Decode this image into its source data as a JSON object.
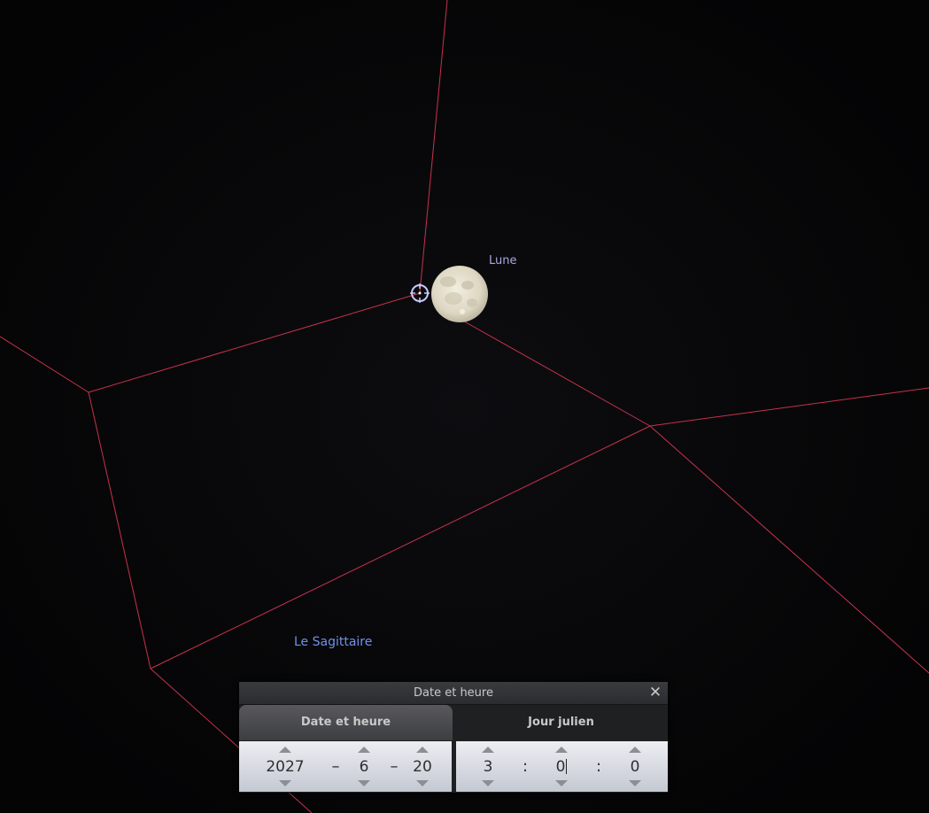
{
  "sky": {
    "object_label": "Lune",
    "constellation_label": "Le Sagittaire",
    "line_color": "#c7324a",
    "moon_color": "#e8e3d0"
  },
  "dialog": {
    "title": "Date et heure",
    "close_icon": "close-icon",
    "tabs": [
      {
        "label": "Date et heure",
        "active": true
      },
      {
        "label": "Jour julien",
        "active": false
      }
    ],
    "date": {
      "year": "2027",
      "month": "6",
      "day": "20",
      "separator": "–"
    },
    "time": {
      "hour": "3",
      "minute": "0",
      "second": "0",
      "separator": ":"
    }
  }
}
